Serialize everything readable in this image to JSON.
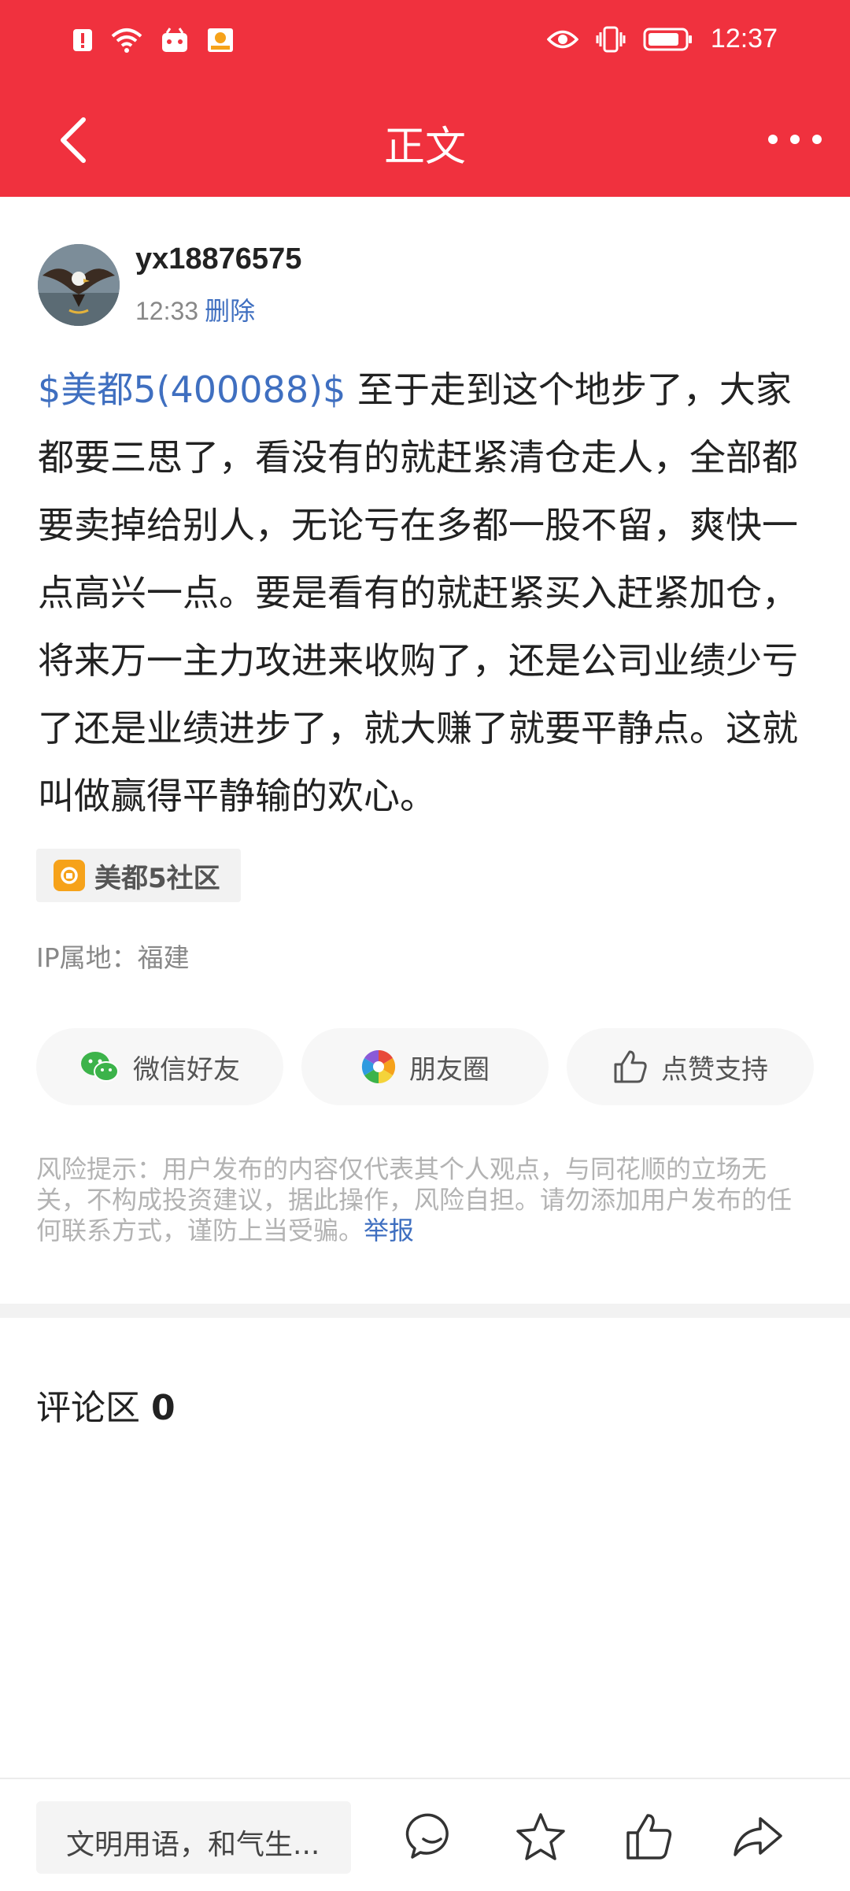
{
  "status_bar": {
    "time": "12:37"
  },
  "header": {
    "title": "正文",
    "back_icon": "chevron-left-icon",
    "more_icon": "more-dots-icon"
  },
  "post": {
    "author": "yx18876575",
    "time": "12:33",
    "delete_label": "删除",
    "stock_link": "$美都5(400088)$",
    "text": " 至于走到这个地步了，大家都要三思了，看没有的就赶紧清仓走人，全部都要卖掉给别人，无论亏在多都一股不留，爽快一点高兴一点。要是看有的就赶紧买入赶紧加仓，将来万一主力攻进来收购了，还是公司业绩少亏了还是业绩进步了，就大赚了就要平静点。这就叫做赢得平静输的欢心。",
    "community_tag": "美都5社区",
    "ip_location": "IP属地：福建"
  },
  "share": {
    "wechat": "微信好友",
    "moments": "朋友圈",
    "like": "点赞支持"
  },
  "risk": {
    "text": "风险提示：用户发布的内容仅代表其个人观点，与同花顺的立场无关，不构成投资建议，据此操作，风险自担。请勿添加用户发布的任何联系方式，谨防上当受骗。",
    "report_label": "举报"
  },
  "comments": {
    "label": "评论区",
    "count": "0"
  },
  "bottom_bar": {
    "input_placeholder": "文明用语，和气生..."
  },
  "colors": {
    "brand_red": "#f0313e",
    "link_blue": "#3f6fc0",
    "tag_orange": "#f6a21a"
  }
}
